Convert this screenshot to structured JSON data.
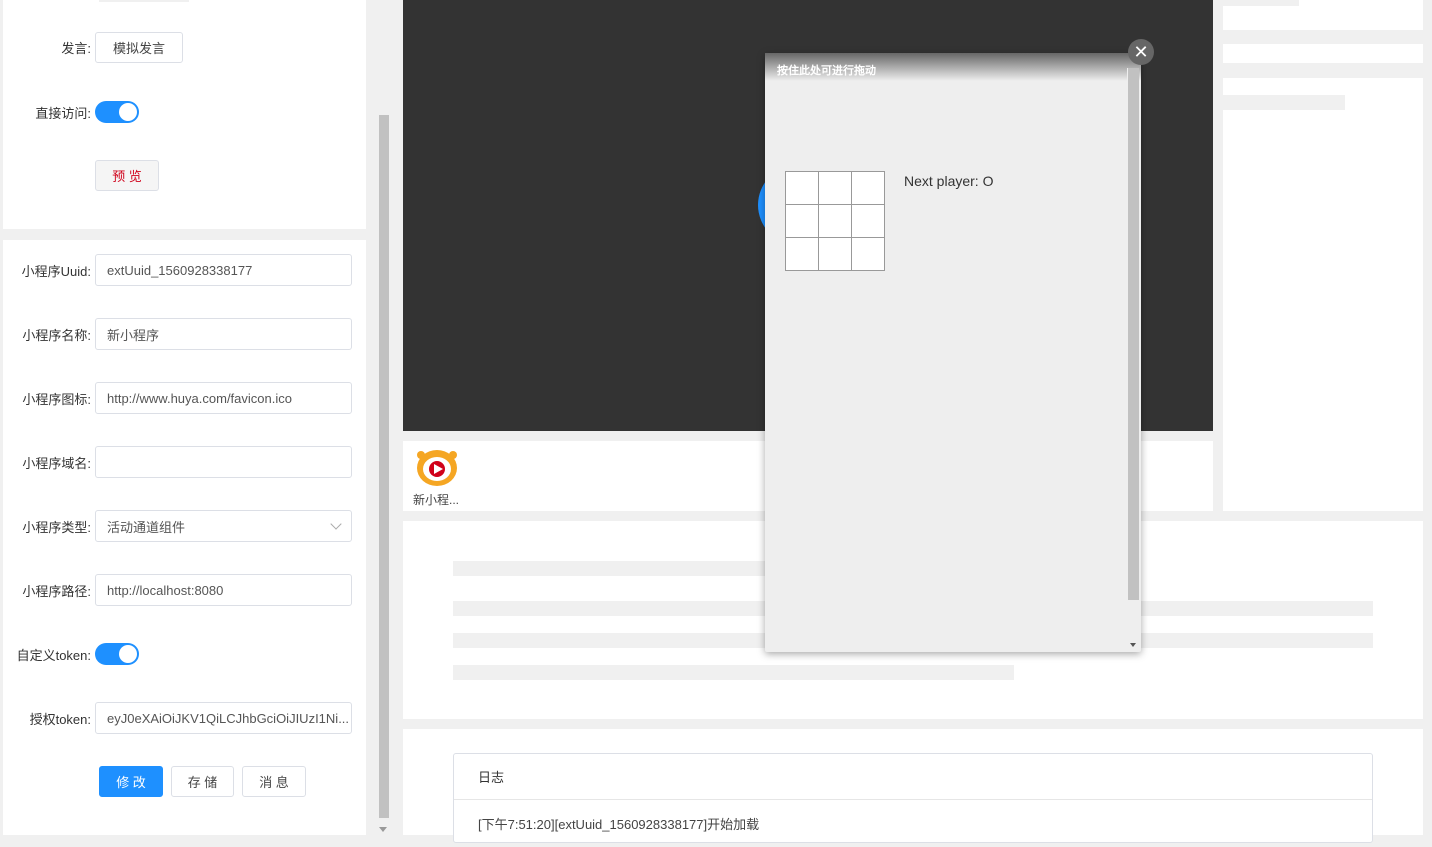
{
  "left_panel": {
    "speak_label": "发言:",
    "speak_button": "模拟发言",
    "direct_access_label": "直接访问:",
    "direct_access_on": true,
    "preview_button": "预 览",
    "fields": [
      {
        "label": "小程序Uuid:",
        "value": "extUuid_1560928338177"
      },
      {
        "label": "小程序名称:",
        "value": "新小程序"
      },
      {
        "label": "小程序图标:",
        "value": "http://www.huya.com/favicon.ico"
      },
      {
        "label": "小程序域名:",
        "value": ""
      },
      {
        "label": "小程序类型:",
        "value": "活动通道组件"
      },
      {
        "label": "小程序路径:",
        "value": "http://localhost:8080"
      }
    ],
    "custom_token_label": "自定义token:",
    "custom_token_on": true,
    "auth_token_label": "授权token:",
    "auth_token_value": "eyJ0eXAiOiJKV1QiLCJhbGciOiJIUzI1Ni...",
    "buttons": {
      "modify": "修 改",
      "save": "存 储",
      "message": "消 息"
    }
  },
  "app_bar": {
    "app_name": "新小程..."
  },
  "popup": {
    "drag_title": "按住此处可进行拖动",
    "close_label": "✕",
    "status": "Next player: O",
    "board": [
      "",
      "",
      "",
      "",
      "",
      "",
      "",
      "",
      ""
    ]
  },
  "log": {
    "title": "日志",
    "lines": [
      "[下午7:51:20][extUuid_1560928338177]开始加载"
    ]
  },
  "colors": {
    "accent": "#1e90ff",
    "video_bg": "#333333",
    "preview_text": "#d0021b"
  }
}
